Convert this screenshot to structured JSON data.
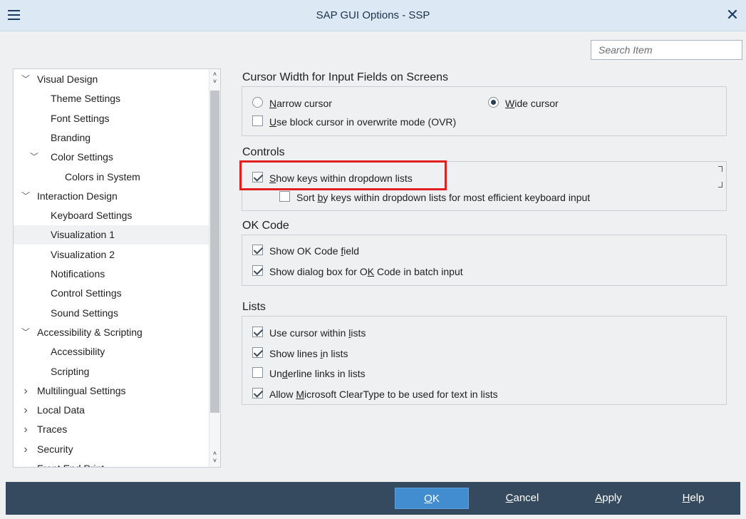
{
  "window": {
    "title": "SAP GUI Options - SSP",
    "close_glyph": "✕"
  },
  "search": {
    "placeholder": "Search Item"
  },
  "tree": {
    "items": [
      {
        "label": "Visual Design",
        "level": 0,
        "expanded": true
      },
      {
        "label": "Theme Settings",
        "level": 1
      },
      {
        "label": "Font Settings",
        "level": 1
      },
      {
        "label": "Branding",
        "level": 1
      },
      {
        "label": "Color Settings",
        "level": 1,
        "expanded": true
      },
      {
        "label": "Colors in System",
        "level": 2
      },
      {
        "label": "Interaction Design",
        "level": 0,
        "expanded": true
      },
      {
        "label": "Keyboard Settings",
        "level": 1
      },
      {
        "label": "Visualization 1",
        "level": 1,
        "selected": true
      },
      {
        "label": "Visualization 2",
        "level": 1
      },
      {
        "label": "Notifications",
        "level": 1
      },
      {
        "label": "Control Settings",
        "level": 1
      },
      {
        "label": "Sound Settings",
        "level": 1
      },
      {
        "label": "Accessibility & Scripting",
        "level": 0,
        "expanded": true
      },
      {
        "label": "Accessibility",
        "level": 1
      },
      {
        "label": "Scripting",
        "level": 1
      },
      {
        "label": "Multilingual Settings",
        "level": 0,
        "expanded": false
      },
      {
        "label": "Local Data",
        "level": 0,
        "expanded": false
      },
      {
        "label": "Traces",
        "level": 0,
        "expanded": false
      },
      {
        "label": "Security",
        "level": 0,
        "expanded": false
      },
      {
        "label": "Front End Print",
        "level": 0,
        "expanded": false
      }
    ]
  },
  "sections": {
    "cursor": {
      "title": "Cursor Width for Input Fields on Screens",
      "narrow_pre": "",
      "narrow_u": "N",
      "narrow_post": "arrow cursor",
      "wide_pre": "",
      "wide_u": "W",
      "wide_post": "ide cursor",
      "block_pre": "",
      "block_u": "U",
      "block_post": "se block cursor in overwrite mode (OVR)",
      "narrow_checked": false,
      "wide_checked": true,
      "block_checked": false
    },
    "controls": {
      "title": "Controls",
      "show_keys_pre": "",
      "show_keys_u": "S",
      "show_keys_post": "how keys within dropdown lists",
      "sort_pre": "Sort ",
      "sort_u": "b",
      "sort_post": "y keys within dropdown lists for most efficient keyboard input",
      "show_keys_checked": true,
      "sort_checked": false
    },
    "okcode": {
      "title": "OK Code",
      "field_pre": "Show OK Code ",
      "field_u": "f",
      "field_post": "ield",
      "dialog_pre": "Show dialog box for O",
      "dialog_u": "K",
      "dialog_post": " Code in batch input",
      "field_checked": true,
      "dialog_checked": true
    },
    "lists": {
      "title": "Lists",
      "cursor_pre": "Use cursor within ",
      "cursor_u": "l",
      "cursor_post": "ists",
      "lines_pre": "Show lines ",
      "lines_u": "i",
      "lines_post": "n lists",
      "underline_pre": "Un",
      "underline_u": "d",
      "underline_post": "erline links in lists",
      "cleartype_pre": "Allow ",
      "cleartype_u": "M",
      "cleartype_post": "icrosoft ClearType to be used for text in lists",
      "cursor_checked": true,
      "lines_checked": true,
      "underline_checked": false,
      "cleartype_checked": true
    }
  },
  "footer": {
    "ok_u": "O",
    "ok_post": "K",
    "cancel_u": "C",
    "cancel_post": "ancel",
    "apply_u": "A",
    "apply_post": "pply",
    "help_u": "H",
    "help_post": "elp"
  },
  "colors": {
    "primary_button": "#428dd0",
    "footer": "#354a5f",
    "highlight": "#e02020",
    "titlebar": "#dce8f4"
  }
}
